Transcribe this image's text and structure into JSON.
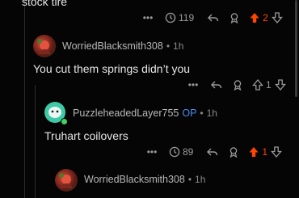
{
  "comments": [
    {
      "body": "stock tire",
      "actions": {
        "more_label": "•••",
        "award_count": "119",
        "vote_count": "2",
        "vote_state": "upvoted"
      }
    },
    {
      "author": "WorriedBlacksmith308",
      "separator": "•",
      "time": "1h",
      "body": "You cut them springs didn’t you",
      "actions": {
        "more_label": "•••",
        "vote_count": "1",
        "vote_state": "neutral"
      }
    },
    {
      "author": "PuzzleheadedLayer755",
      "op_badge": "OP",
      "separator": "•",
      "time": "1h",
      "body": "Truhart coilovers",
      "actions": {
        "more_label": "•••",
        "award_count": "89",
        "vote_count": "1",
        "vote_state": "upvoted"
      }
    },
    {
      "author": "WorriedBlacksmith308",
      "separator": "•",
      "time": "1h"
    }
  ],
  "colors": {
    "upvote": "#ff4500",
    "op": "#4b8cf0",
    "online": "#46d160"
  },
  "icons": [
    "more-icon",
    "award-icon",
    "reply-icon",
    "share-icon",
    "upvote-icon",
    "downvote-icon"
  ]
}
